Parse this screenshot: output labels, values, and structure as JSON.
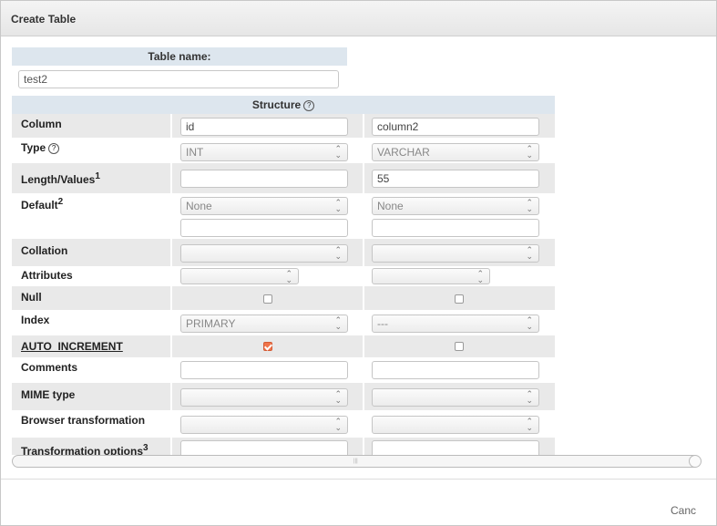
{
  "dialog": {
    "title": "Create Table"
  },
  "table_name": {
    "header": "Table name:",
    "value": "test2"
  },
  "structure": {
    "header": "Structure",
    "help_icon": "help-icon",
    "columns": [
      {
        "name": "id",
        "type": "INT",
        "length": "",
        "default": "None",
        "collation": "",
        "attributes": "",
        "null": false,
        "index": "PRIMARY",
        "auto_increment": true,
        "comments": "",
        "mime_type": "",
        "browser_transformation": ""
      },
      {
        "name": "column2",
        "type": "VARCHAR",
        "length": "55",
        "default": "None",
        "collation": "",
        "attributes": "",
        "null": false,
        "index": "---",
        "auto_increment": false,
        "comments": "",
        "mime_type": "",
        "browser_transformation": ""
      }
    ],
    "row_labels": {
      "column": "Column",
      "type": "Type",
      "length": "Length/Values",
      "length_sup": "1",
      "default": "Default",
      "default_sup": "2",
      "collation": "Collation",
      "attributes": "Attributes",
      "null": "Null",
      "index": "Index",
      "auto_increment": "AUTO_INCREMENT",
      "comments": "Comments",
      "mime_type": "MIME type",
      "browser_transformation": "Browser transformation",
      "transformation_options": "Transformation options",
      "transformation_options_sup": "3"
    }
  },
  "buttons": {
    "cancel": "Canc"
  },
  "colors": {
    "header_bg": "#dde6ee",
    "row_alt_bg": "#e9e9e9",
    "checkbox_checked": "#f0744a"
  }
}
